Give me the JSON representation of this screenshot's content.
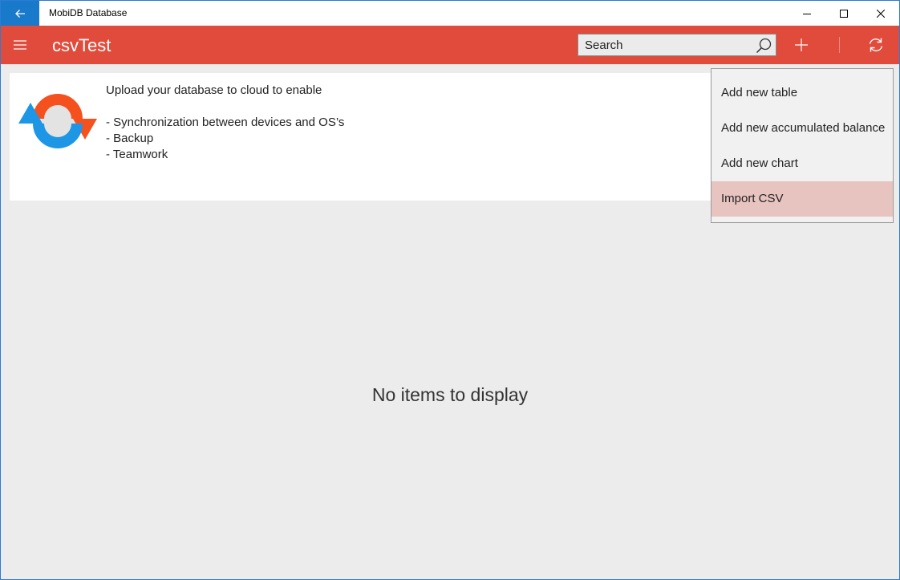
{
  "window": {
    "title": "MobiDB Database"
  },
  "appbar": {
    "title": "csvTest"
  },
  "search": {
    "placeholder": "Search"
  },
  "card": {
    "heading": "Upload your database to cloud to enable",
    "bullets": [
      "- Synchronization between devices and OS’s",
      "- Backup",
      "- Teamwork"
    ]
  },
  "main": {
    "empty_text": "No items to display"
  },
  "menu": {
    "items": [
      {
        "label": "Add new table"
      },
      {
        "label": "Add new accumulated balance"
      },
      {
        "label": "Add new chart"
      },
      {
        "label": "Import CSV",
        "highlighted": true
      }
    ]
  },
  "colors": {
    "appbar": "#e14b3b",
    "back_button": "#1979ca",
    "menu_highlight": "#e8c4c1",
    "sync_blue": "#1e96e6",
    "sync_orange": "#f4511e"
  }
}
